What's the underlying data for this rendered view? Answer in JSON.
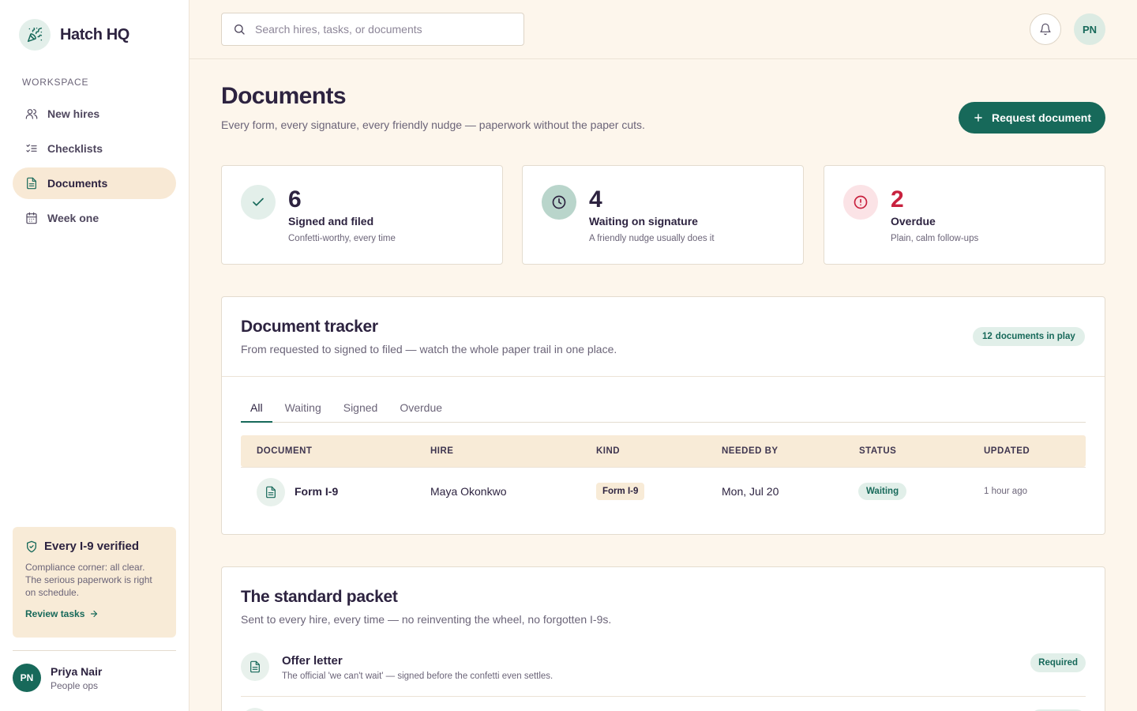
{
  "app": {
    "name": "Hatch HQ",
    "logo_icon": "party-popper-icon"
  },
  "sidebar": {
    "section_label": "Workspace",
    "items": [
      {
        "label": "New hires",
        "icon": "users-icon",
        "active": false
      },
      {
        "label": "Checklists",
        "icon": "checklist-icon",
        "active": false
      },
      {
        "label": "Documents",
        "icon": "document-icon",
        "active": true
      },
      {
        "label": "Week one",
        "icon": "calendar-icon",
        "active": false
      }
    ],
    "compliance": {
      "title": "Every I-9 verified",
      "text": "Compliance corner: all clear. The serious paperwork is right on schedule.",
      "link": "Review tasks"
    },
    "user": {
      "initials": "PN",
      "name": "Priya Nair",
      "role": "People ops"
    }
  },
  "topbar": {
    "search_placeholder": "Search hires, tasks, or documents",
    "avatar_initials": "PN"
  },
  "page": {
    "title": "Documents",
    "subtitle": "Every form, every signature, every friendly nudge — paperwork without the paper cuts.",
    "request_button": "Request document"
  },
  "stats": [
    {
      "value": "6",
      "label": "Signed and filed",
      "note": "Confetti-worthy, every time",
      "color": "#2d2340"
    },
    {
      "value": "4",
      "label": "Waiting on signature",
      "note": "A friendly nudge usually does it",
      "color": "#2d2340"
    },
    {
      "value": "2",
      "label": "Overdue",
      "note": "Plain, calm follow-ups",
      "color": "#c8213e"
    }
  ],
  "tracker": {
    "title": "Document tracker",
    "subtitle": "From requested to signed to filed — watch the whole paper trail in one place.",
    "count": "12",
    "count_label": "documents in play",
    "tabs": [
      "All",
      "Waiting",
      "Signed",
      "Overdue"
    ],
    "active_tab": "All",
    "columns": [
      "Document",
      "Hire",
      "Kind",
      "Needed by",
      "Status",
      "Updated"
    ],
    "rows": [
      {
        "document": "Form I-9",
        "hire": "Maya Okonkwo",
        "kind": "Form I-9",
        "needed_by": "Mon, Jul 20",
        "status": "Waiting",
        "updated": "1 hour ago"
      }
    ]
  },
  "packet": {
    "title": "The standard packet",
    "subtitle": "Sent to every hire, every time — no reinventing the wheel, no forgotten I-9s.",
    "items": [
      {
        "name": "Offer letter",
        "desc": "The official 'we can't wait' — signed before the confetti even settles.",
        "badge": "Required"
      }
    ]
  },
  "colors": {
    "brand": "#17695a",
    "background": "#fdf6ec",
    "accent_warm": "#f8ebd7",
    "danger": "#c8213e"
  }
}
